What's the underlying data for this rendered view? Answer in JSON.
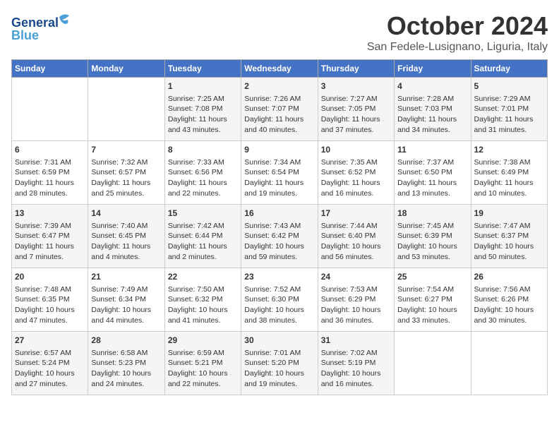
{
  "logo": {
    "line1": "General",
    "line2": "Blue"
  },
  "title": "October 2024",
  "location": "San Fedele-Lusignano, Liguria, Italy",
  "weekdays": [
    "Sunday",
    "Monday",
    "Tuesday",
    "Wednesday",
    "Thursday",
    "Friday",
    "Saturday"
  ],
  "weeks": [
    [
      {
        "day": "",
        "info": ""
      },
      {
        "day": "",
        "info": ""
      },
      {
        "day": "1",
        "info": "Sunrise: 7:25 AM\nSunset: 7:08 PM\nDaylight: 11 hours\nand 43 minutes."
      },
      {
        "day": "2",
        "info": "Sunrise: 7:26 AM\nSunset: 7:07 PM\nDaylight: 11 hours\nand 40 minutes."
      },
      {
        "day": "3",
        "info": "Sunrise: 7:27 AM\nSunset: 7:05 PM\nDaylight: 11 hours\nand 37 minutes."
      },
      {
        "day": "4",
        "info": "Sunrise: 7:28 AM\nSunset: 7:03 PM\nDaylight: 11 hours\nand 34 minutes."
      },
      {
        "day": "5",
        "info": "Sunrise: 7:29 AM\nSunset: 7:01 PM\nDaylight: 11 hours\nand 31 minutes."
      }
    ],
    [
      {
        "day": "6",
        "info": "Sunrise: 7:31 AM\nSunset: 6:59 PM\nDaylight: 11 hours\nand 28 minutes."
      },
      {
        "day": "7",
        "info": "Sunrise: 7:32 AM\nSunset: 6:57 PM\nDaylight: 11 hours\nand 25 minutes."
      },
      {
        "day": "8",
        "info": "Sunrise: 7:33 AM\nSunset: 6:56 PM\nDaylight: 11 hours\nand 22 minutes."
      },
      {
        "day": "9",
        "info": "Sunrise: 7:34 AM\nSunset: 6:54 PM\nDaylight: 11 hours\nand 19 minutes."
      },
      {
        "day": "10",
        "info": "Sunrise: 7:35 AM\nSunset: 6:52 PM\nDaylight: 11 hours\nand 16 minutes."
      },
      {
        "day": "11",
        "info": "Sunrise: 7:37 AM\nSunset: 6:50 PM\nDaylight: 11 hours\nand 13 minutes."
      },
      {
        "day": "12",
        "info": "Sunrise: 7:38 AM\nSunset: 6:49 PM\nDaylight: 11 hours\nand 10 minutes."
      }
    ],
    [
      {
        "day": "13",
        "info": "Sunrise: 7:39 AM\nSunset: 6:47 PM\nDaylight: 11 hours\nand 7 minutes."
      },
      {
        "day": "14",
        "info": "Sunrise: 7:40 AM\nSunset: 6:45 PM\nDaylight: 11 hours\nand 4 minutes."
      },
      {
        "day": "15",
        "info": "Sunrise: 7:42 AM\nSunset: 6:44 PM\nDaylight: 11 hours\nand 2 minutes."
      },
      {
        "day": "16",
        "info": "Sunrise: 7:43 AM\nSunset: 6:42 PM\nDaylight: 10 hours\nand 59 minutes."
      },
      {
        "day": "17",
        "info": "Sunrise: 7:44 AM\nSunset: 6:40 PM\nDaylight: 10 hours\nand 56 minutes."
      },
      {
        "day": "18",
        "info": "Sunrise: 7:45 AM\nSunset: 6:39 PM\nDaylight: 10 hours\nand 53 minutes."
      },
      {
        "day": "19",
        "info": "Sunrise: 7:47 AM\nSunset: 6:37 PM\nDaylight: 10 hours\nand 50 minutes."
      }
    ],
    [
      {
        "day": "20",
        "info": "Sunrise: 7:48 AM\nSunset: 6:35 PM\nDaylight: 10 hours\nand 47 minutes."
      },
      {
        "day": "21",
        "info": "Sunrise: 7:49 AM\nSunset: 6:34 PM\nDaylight: 10 hours\nand 44 minutes."
      },
      {
        "day": "22",
        "info": "Sunrise: 7:50 AM\nSunset: 6:32 PM\nDaylight: 10 hours\nand 41 minutes."
      },
      {
        "day": "23",
        "info": "Sunrise: 7:52 AM\nSunset: 6:30 PM\nDaylight: 10 hours\nand 38 minutes."
      },
      {
        "day": "24",
        "info": "Sunrise: 7:53 AM\nSunset: 6:29 PM\nDaylight: 10 hours\nand 36 minutes."
      },
      {
        "day": "25",
        "info": "Sunrise: 7:54 AM\nSunset: 6:27 PM\nDaylight: 10 hours\nand 33 minutes."
      },
      {
        "day": "26",
        "info": "Sunrise: 7:56 AM\nSunset: 6:26 PM\nDaylight: 10 hours\nand 30 minutes."
      }
    ],
    [
      {
        "day": "27",
        "info": "Sunrise: 6:57 AM\nSunset: 5:24 PM\nDaylight: 10 hours\nand 27 minutes."
      },
      {
        "day": "28",
        "info": "Sunrise: 6:58 AM\nSunset: 5:23 PM\nDaylight: 10 hours\nand 24 minutes."
      },
      {
        "day": "29",
        "info": "Sunrise: 6:59 AM\nSunset: 5:21 PM\nDaylight: 10 hours\nand 22 minutes."
      },
      {
        "day": "30",
        "info": "Sunrise: 7:01 AM\nSunset: 5:20 PM\nDaylight: 10 hours\nand 19 minutes."
      },
      {
        "day": "31",
        "info": "Sunrise: 7:02 AM\nSunset: 5:19 PM\nDaylight: 10 hours\nand 16 minutes."
      },
      {
        "day": "",
        "info": ""
      },
      {
        "day": "",
        "info": ""
      }
    ]
  ]
}
